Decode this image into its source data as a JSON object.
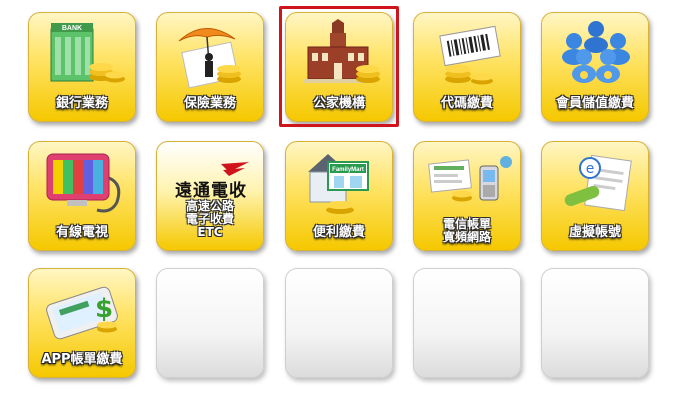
{
  "tiles": [
    {
      "label": "銀行業務",
      "icon": "bank-icon",
      "bank_sign": "BANK"
    },
    {
      "label": "保險業務",
      "icon": "insurance-umbrella-icon"
    },
    {
      "label": "公家機構",
      "icon": "government-building-icon",
      "selected": true
    },
    {
      "label": "代碼繳費",
      "icon": "barcode-payment-icon"
    },
    {
      "label": "會員儲值繳費",
      "icon": "member-stored-value-icon"
    },
    {
      "label": "有線電視",
      "icon": "cable-tv-icon"
    },
    {
      "brand": "遠通電收",
      "lines": [
        "高速公路",
        "電子收費",
        "ETC"
      ],
      "icon": "etc-logo-icon"
    },
    {
      "label": "便利繳費",
      "icon": "convenience-store-icon",
      "store_sign": "FamilyMart"
    },
    {
      "lines": [
        "電信帳單",
        "寬頻網路"
      ],
      "icon": "telecom-bill-icon"
    },
    {
      "label": "虛擬帳號",
      "icon": "virtual-account-icon"
    },
    {
      "label": "APP帳單繳費",
      "icon": "app-bill-payment-icon"
    }
  ],
  "colors": {
    "tile_gold": "#f5c800",
    "selected_border": "#d0141b",
    "label_text": "#ffffff"
  }
}
